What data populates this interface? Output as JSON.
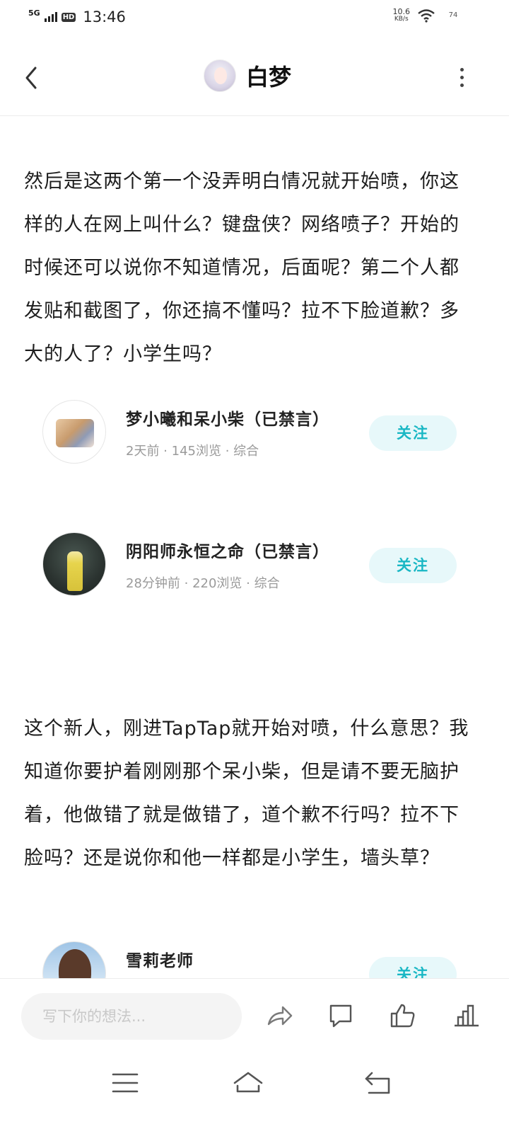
{
  "status_bar": {
    "network": "5G",
    "hd": "HD",
    "time": "13:46",
    "speed_value": "10.6",
    "speed_unit": "KB/s",
    "battery": "74"
  },
  "header": {
    "title": "白梦",
    "back_icon": "chevron-left-icon",
    "more_icon": "more-vertical-icon"
  },
  "post": {
    "paragraph_1": "然后是这两个第一个没弄明白情况就开始喷，你这样的人在网上叫什么？键盘侠？网络喷子？开始的时候还可以说你不知道情况，后面呢？第二个人都发贴和截图了，你还搞不懂吗？拉不下脸道歉？多大的人了？小学生吗？",
    "paragraph_2": "这个新人，刚进TapTap就开始对喷，什么意思？我知道你要护着刚刚那个呆小柴，但是请不要无脑护着，他做错了就是做错了，道个歉不行吗？拉不下脸吗？还是说你和他一样都是小学生，墙头草？"
  },
  "cards": [
    {
      "name": "梦小曦和呆小柴（已禁言）",
      "meta": "2天前 · 145浏览 · 综合",
      "follow_label": "关注"
    },
    {
      "name": "阴阳师永恒之命（已禁言）",
      "meta": "28分钟前 · 220浏览 · 综合",
      "follow_label": "关注"
    },
    {
      "name": "雪莉老师",
      "meta": "",
      "follow_label": "关注"
    }
  ],
  "action_bar": {
    "input_placeholder": "写下你的想法...",
    "icons": [
      "share-icon",
      "comment-icon",
      "like-icon",
      "stats-icon"
    ]
  },
  "nav_bar": {
    "icons": [
      "menu-icon",
      "home-icon",
      "back-icon"
    ]
  },
  "colors": {
    "accent": "#19b7c4",
    "follow_bg": "#e7f8fa",
    "meta_text": "#9a9a9a"
  }
}
